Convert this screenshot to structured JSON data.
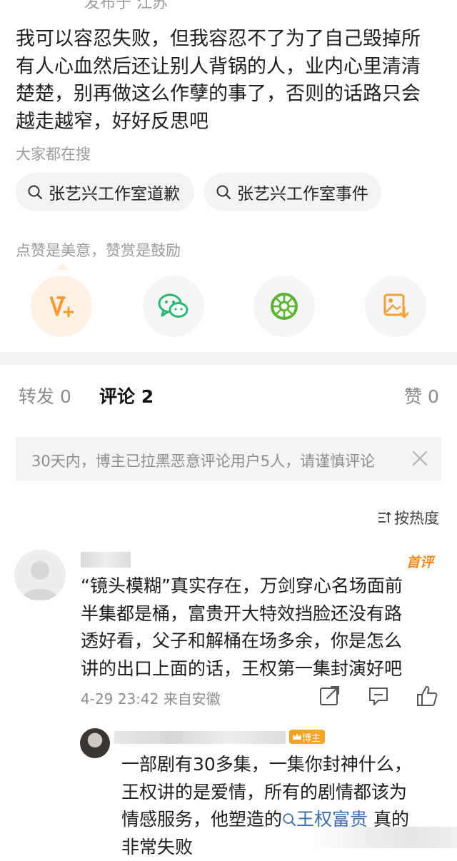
{
  "post": {
    "location": "发布于 江苏",
    "lines": [
      "我可以容忍失败，但我容忍不了为了自己毁掉所",
      "有人心血然后还让别人背锅的人，业内心里清清",
      "楚楚，别再做这么作孽的事了，否则的话路只会",
      "越走越窄，好好反思吧"
    ]
  },
  "search": {
    "label": "大家都在搜",
    "chips": [
      "张艺兴工作室道歉",
      "张艺兴工作室事件"
    ]
  },
  "reward": {
    "label": "点赞是美意，赞赏是鼓励",
    "buttons": [
      "v-plus-icon",
      "wechat-icon",
      "moments-icon",
      "save-image-icon"
    ]
  },
  "tabs": [
    {
      "label": "转发",
      "count": "0"
    },
    {
      "label": "评论",
      "count": "2"
    },
    {
      "label": "赞",
      "count": "0"
    }
  ],
  "notice": {
    "text": "30天内，博主已拉黑恶意评论用户5人，请谨慎评论"
  },
  "sort": {
    "label": "按热度"
  },
  "comment1": {
    "badge": "首评",
    "lines": [
      "“镜头模糊”真实存在，万剑穿心名场面前",
      "半集都是桶，富贵开大特效挡脸还没有路",
      "透好看，父子和解桶在场多余，你是怎么",
      "讲的出口上面的话，王权第一集封演好吧"
    ],
    "time": "4-29 23:42",
    "source": "来自安徽"
  },
  "comment2": {
    "badge": "博主",
    "line1": "一部剧有30多集，一集你封神什么，",
    "line2": "王权讲的是爱情，所有的剧情都该为",
    "line3_prefix": "情感服务，他塑造的",
    "link": "王权富贵",
    "line3_suffix": " 真的",
    "line4": "非常失败"
  },
  "colors": {
    "accent": "#f39a2f",
    "link": "#3d6ea8",
    "wechat": "#2bb673",
    "moments": "#5cb531",
    "save": "#f0a23a"
  }
}
